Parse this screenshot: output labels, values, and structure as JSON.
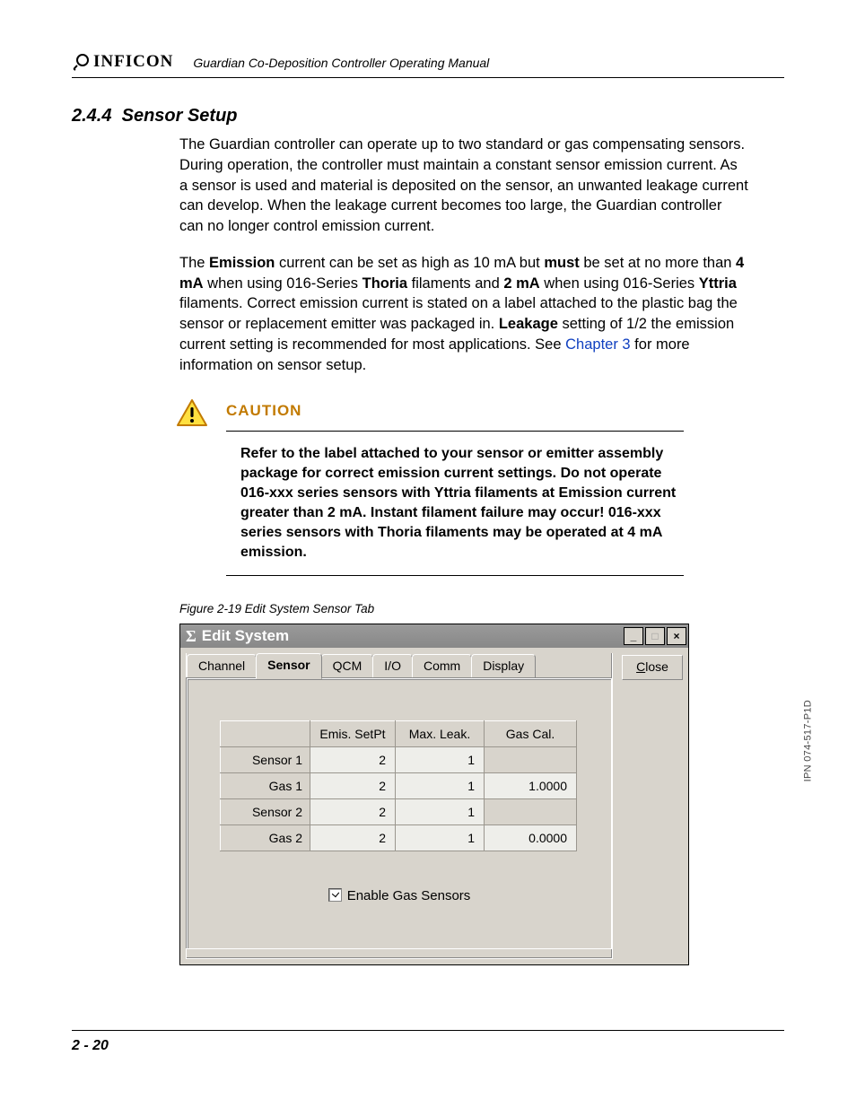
{
  "header": {
    "brand": "INFICON",
    "manual_title": "Guardian Co-Deposition Controller Operating Manual"
  },
  "section": {
    "number": "2.4.4",
    "title": "Sensor Setup"
  },
  "para1": "The Guardian controller can operate up to two standard or gas compensating sensors. During operation, the controller must maintain a constant sensor emission current. As a sensor is used and material is deposited on the sensor, an unwanted leakage current can develop. When the leakage current becomes too large, the Guardian controller can no longer control emission current.",
  "para2": {
    "t1": "The ",
    "b1": "Emission",
    "t2": " current can be set as high as 10 mA but ",
    "b2": "must",
    "t3": " be set at no more than ",
    "b3": "4 mA",
    "t4": " when using 016-Series ",
    "b4": "Thoria",
    "t5": " filaments and ",
    "b5": "2 mA",
    "t6": " when using 016-Series ",
    "b6": "Yttria",
    "t7": " filaments. Correct emission current is stated on a label attached to the plastic bag the sensor or replacement emitter was packaged in. ",
    "b7": "Leakage",
    "t8": " setting of 1/2 the emission current setting is recommended for most applications. See ",
    "link": "Chapter 3",
    "t9": " for more information on sensor setup."
  },
  "caution": {
    "label": "CAUTION",
    "text": "Refer to the label attached to your sensor or emitter assembly package for correct emission current settings. Do not operate 016-xxx series sensors with Yttria filaments at Emission current greater than 2 mA. Instant filament failure may occur! 016-xxx series sensors with Thoria filaments may be operated at 4 mA emission."
  },
  "figure_caption": "Figure 2-19  Edit System Sensor Tab",
  "dialog": {
    "title": "Edit System",
    "tabs": [
      "Channel",
      "Sensor",
      "QCM",
      "I/O",
      "Comm",
      "Display"
    ],
    "active_tab_index": 1,
    "close_label": "Close",
    "columns": [
      "Emis. SetPt",
      "Max. Leak.",
      "Gas Cal."
    ],
    "rows": [
      {
        "label": "Sensor 1",
        "emis": "2",
        "leak": "1",
        "gas": ""
      },
      {
        "label": "Gas 1",
        "emis": "2",
        "leak": "1",
        "gas": "1.0000"
      },
      {
        "label": "Sensor 2",
        "emis": "2",
        "leak": "1",
        "gas": ""
      },
      {
        "label": "Gas 2",
        "emis": "2",
        "leak": "1",
        "gas": "0.0000"
      }
    ],
    "checkbox_label": "Enable Gas Sensors",
    "checkbox_checked": true
  },
  "side_ipn": "IPN 074-517-P1D",
  "page_number": "2 - 20"
}
